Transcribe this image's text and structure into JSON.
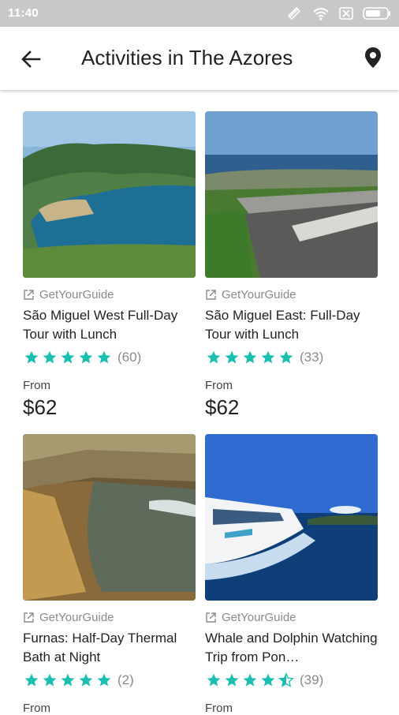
{
  "status_bar": {
    "time": "11:40"
  },
  "header": {
    "title": "Activities in The Azores"
  },
  "activities": [
    {
      "provider": "GetYourGuide",
      "title": "São Miguel West Full-Day Tour with Lunch",
      "rating": 5,
      "reviews": "(60)",
      "from_label": "From",
      "price": "$62"
    },
    {
      "provider": "GetYourGuide",
      "title": "São Miguel East: Full-Day Tour with Lunch",
      "rating": 5,
      "reviews": "(33)",
      "from_label": "From",
      "price": "$62"
    },
    {
      "provider": "GetYourGuide",
      "title": "Furnas: Half-Day Thermal Bath at Night",
      "rating": 5,
      "reviews": "(2)",
      "from_label": "From",
      "price": ""
    },
    {
      "provider": "GetYourGuide",
      "title": "Whale and Dolphin Watching Trip from Pon…",
      "rating": 4.5,
      "reviews": "(39)",
      "from_label": "From",
      "price": ""
    }
  ],
  "colors": {
    "accent": "#1bbfb0",
    "status_bar": "#c8c8c8",
    "provider_text": "#8a8a8a"
  },
  "icons": [
    "back-arrow-icon",
    "location-pin-icon",
    "external-link-icon",
    "star-icon"
  ]
}
